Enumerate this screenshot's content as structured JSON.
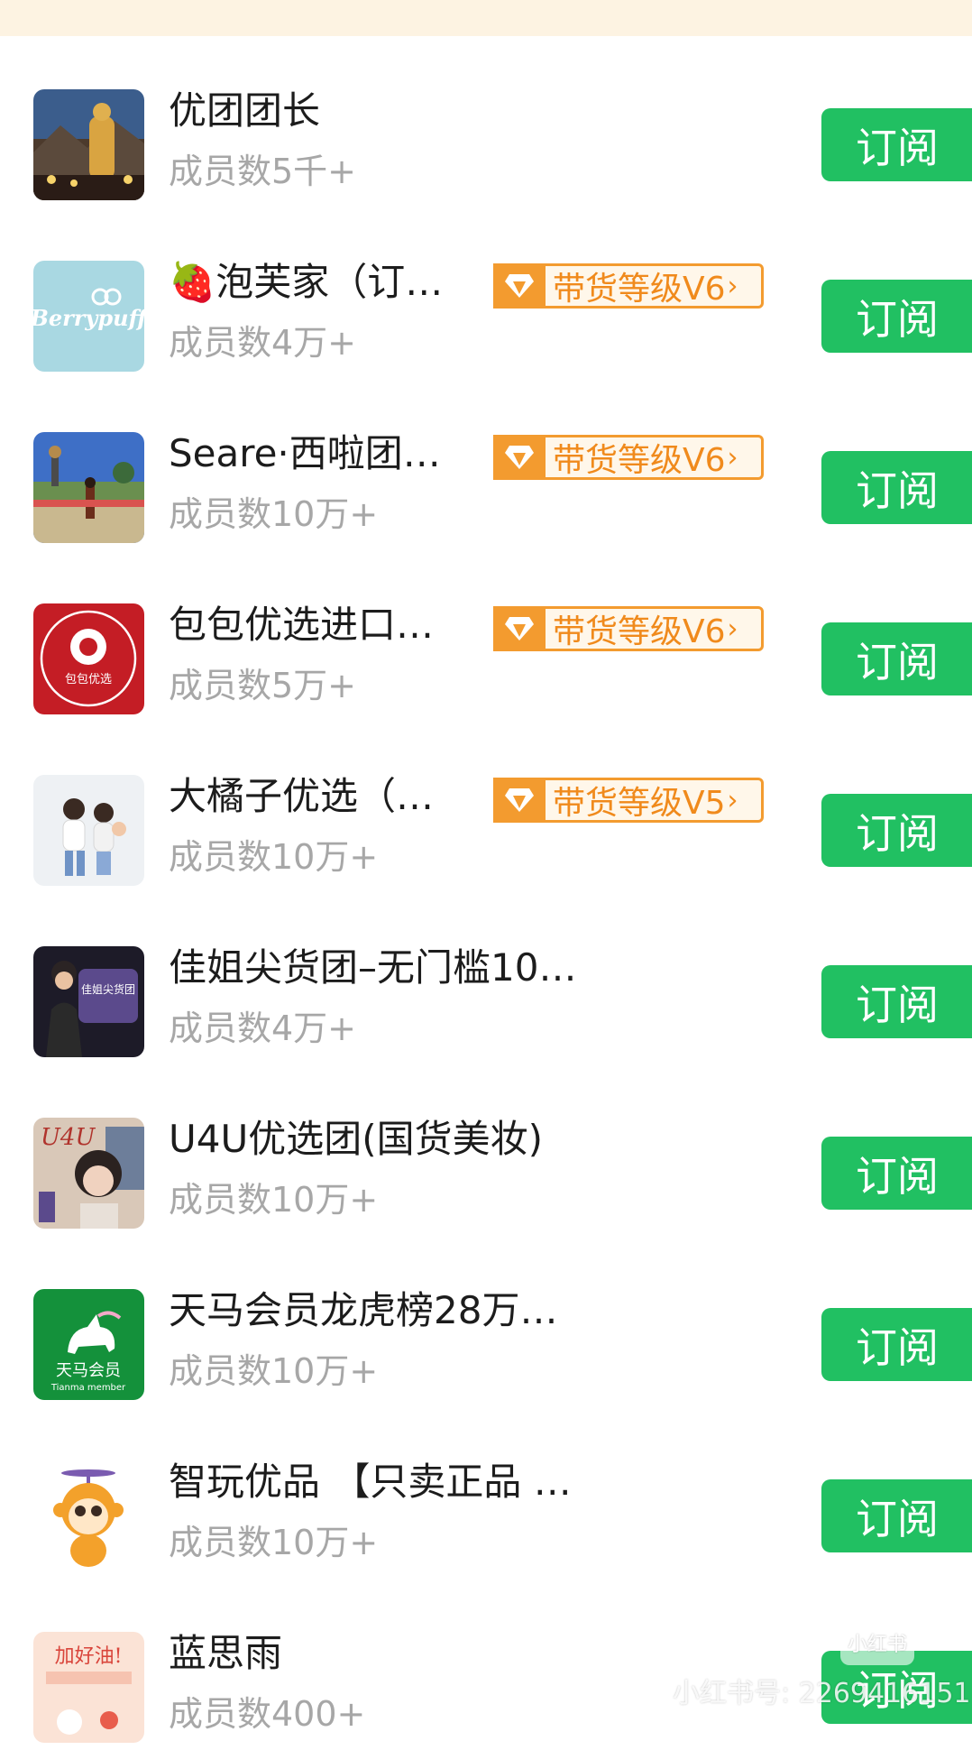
{
  "subscribe_label": "订阅",
  "colors": {
    "accent_green": "#21c062",
    "badge_orange": "#f39b2f",
    "member_gray": "#a7a7a7"
  },
  "groups": [
    {
      "name": "优团团长",
      "members": "成员数5千+",
      "badge": ""
    },
    {
      "name": "🍓泡芙家（订…",
      "members": "成员数4万+",
      "badge": "带货等级V6"
    },
    {
      "name": "Seare·西啦团…",
      "members": "成员数10万+",
      "badge": "带货等级V6"
    },
    {
      "name": "包包优选进口…",
      "members": "成员数5万+",
      "badge": "带货等级V6"
    },
    {
      "name": "大橘子优选（…",
      "members": "成员数10万+",
      "badge": "带货等级V5"
    },
    {
      "name": "佳姐尖货团–无门槛10…",
      "members": "成员数4万+",
      "badge": ""
    },
    {
      "name": "U4U优选团(国货美妆)",
      "members": "成员数10万+",
      "badge": ""
    },
    {
      "name": "天马会员龙虎榜28万…",
      "members": "成员数10万+",
      "badge": ""
    },
    {
      "name": "智玩优品 【只卖正品 …",
      "members": "成员数10万+",
      "badge": ""
    },
    {
      "name": "蓝思雨",
      "members": "成员数400+",
      "badge": ""
    }
  ],
  "avatars": {
    "berrypuff_text": "Berrypuff",
    "baobao_text": "包包优选",
    "jiajie_text": "佳姐尖货团",
    "u4u_text": "U4U",
    "tianma_text": "天马会员",
    "tianma_sub": "Tianma member",
    "lansiyu_text": "加好油!"
  },
  "watermark": {
    "text": "小红书号: 2269416151",
    "logo": "小红书"
  }
}
